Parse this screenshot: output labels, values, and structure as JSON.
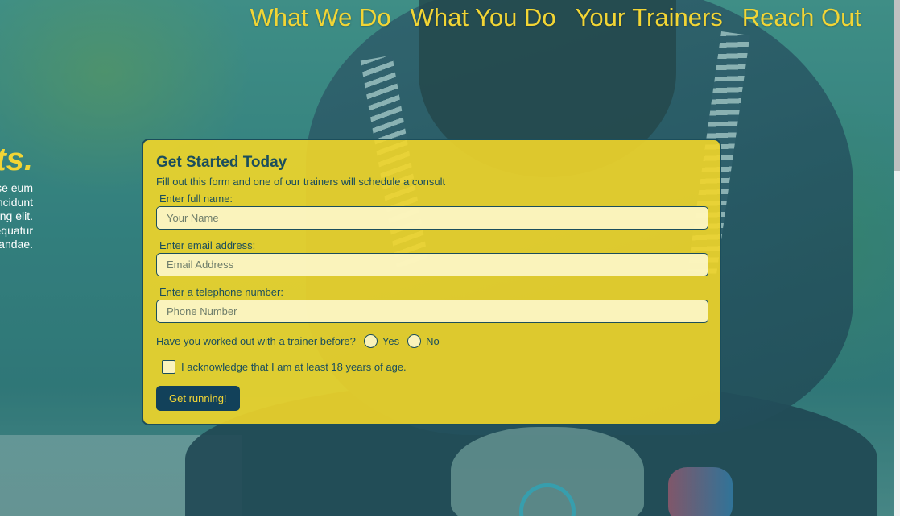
{
  "nav": {
    "items": [
      "What We Do",
      "What You Do",
      "Your Trainers",
      "Reach Out"
    ]
  },
  "side": {
    "heading": "ts.",
    "lines": [
      "sse eum",
      "incidunt",
      "cing elit.",
      "equatur",
      "sandae."
    ]
  },
  "form": {
    "title": "Get Started Today",
    "subtitle": "Fill out this form and one of our trainers will schedule a consult",
    "name_label": "Enter full name:",
    "name_placeholder": "Your Name",
    "email_label": "Enter email address:",
    "email_placeholder": "Email Address",
    "phone_label": "Enter a telephone number:",
    "phone_placeholder": "Phone Number",
    "trainer_question": "Have you worked out with a trainer before?",
    "option_yes": "Yes",
    "option_no": "No",
    "acknowledge": "I acknowledge that I am at least 18 years of age.",
    "submit_label": "Get running!"
  },
  "colors": {
    "accent": "#f2d535",
    "dark": "#1b4e5c",
    "button": "#12415a"
  }
}
